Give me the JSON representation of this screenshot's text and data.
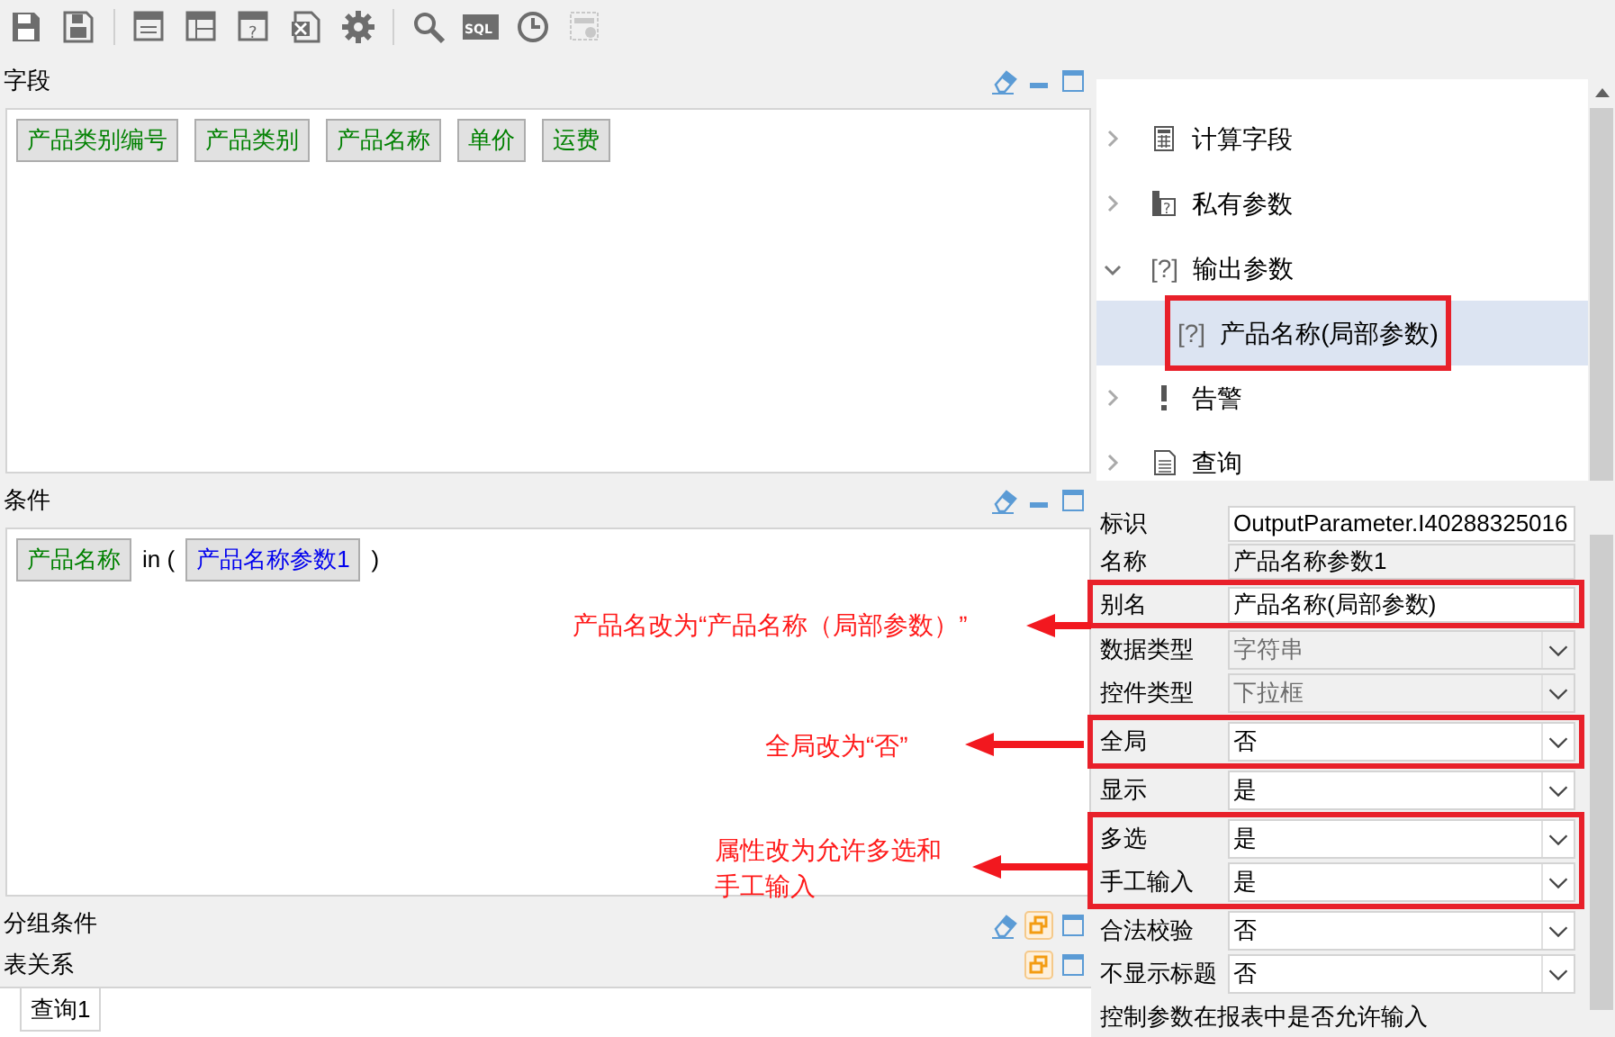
{
  "toolbar": [
    {
      "kind": "save",
      "disabled": false
    },
    {
      "kind": "save-as",
      "disabled": false
    },
    {
      "kind": "layout",
      "disabled": false
    },
    {
      "kind": "table",
      "disabled": false
    },
    {
      "kind": "param",
      "symbol": "?",
      "disabled": false
    },
    {
      "kind": "excel",
      "disabled": false
    },
    {
      "kind": "gear",
      "disabled": false
    },
    {
      "kind": "search",
      "disabled": false
    },
    {
      "kind": "sql",
      "symbol": "SQL",
      "disabled": false
    },
    {
      "kind": "clock",
      "disabled": false
    },
    {
      "kind": "window",
      "disabled": true
    }
  ],
  "fields_panel": {
    "title": "字段",
    "tools": [
      {
        "kind": "eraser"
      },
      {
        "kind": "minimize"
      },
      {
        "kind": "maximize"
      }
    ],
    "chips": [
      "产品类别编号",
      "产品类别",
      "产品名称",
      "单价",
      "运费"
    ]
  },
  "condition_panel": {
    "title": "条件",
    "tools": [
      {
        "kind": "eraser"
      },
      {
        "kind": "minimize"
      },
      {
        "kind": "maximize"
      }
    ],
    "tokens": [
      {
        "kind": "field",
        "text": "产品名称"
      },
      {
        "kind": "text",
        "text": "in ("
      },
      {
        "kind": "param",
        "text": "产品名称参数1"
      },
      {
        "kind": "text",
        "text": ")"
      }
    ]
  },
  "group_panel": {
    "title": "分组条件",
    "tools": [
      {
        "kind": "eraser"
      },
      {
        "kind": "restore"
      },
      {
        "kind": "maximize"
      }
    ]
  },
  "relation_panel": {
    "title": "表关系",
    "tools": [
      {
        "kind": "restore"
      },
      {
        "kind": "maximize"
      }
    ],
    "tabs": [
      {
        "label": "查询1",
        "selected": true
      }
    ]
  },
  "tree": [
    {
      "label": "计算字段",
      "kind": "calculator",
      "expanded": false,
      "selected": false,
      "highlighted": false
    },
    {
      "label": "私有参数",
      "kind": "private-param",
      "symbol": "?",
      "expanded": false,
      "selected": false,
      "highlighted": false
    },
    {
      "label": "输出参数",
      "kind": "param",
      "symbol": "[?]",
      "expanded": true,
      "selected": false,
      "highlighted": false,
      "children": [
        {
          "label": "产品名称(局部参数)",
          "kind": "param",
          "symbol": "[?]",
          "selected": true,
          "highlighted": true
        }
      ]
    },
    {
      "label": "告警",
      "kind": "alert",
      "expanded": false,
      "selected": false,
      "highlighted": false
    },
    {
      "label": "查询",
      "kind": "document",
      "expanded": false,
      "selected": false,
      "highlighted": false
    }
  ],
  "properties": [
    {
      "label": "标识",
      "kind": "text",
      "value": "OutputParameter.I40288325016",
      "disabled": false,
      "highlighted": false
    },
    {
      "label": "名称",
      "kind": "text",
      "value": "产品名称参数1",
      "disabled": true,
      "highlighted": false
    },
    {
      "label": "别名",
      "kind": "text",
      "value": "产品名称(局部参数)",
      "disabled": false,
      "highlighted": true
    },
    {
      "label": "数据类型",
      "kind": "select",
      "value": "字符串",
      "disabled": true,
      "highlighted": false
    },
    {
      "label": "控件类型",
      "kind": "select",
      "value": "下拉框",
      "disabled": true,
      "highlighted": false
    },
    {
      "label": "全局",
      "kind": "select",
      "value": "否",
      "disabled": false,
      "highlighted": true
    },
    {
      "label": "显示",
      "kind": "select",
      "value": "是",
      "disabled": false,
      "highlighted": false
    },
    {
      "label": "多选",
      "kind": "select",
      "value": "是",
      "disabled": false,
      "highlighted": true
    },
    {
      "label": "手工输入",
      "kind": "select",
      "value": "是",
      "disabled": false,
      "highlighted": true
    },
    {
      "label": "合法校验",
      "kind": "select",
      "value": "否",
      "disabled": false,
      "highlighted": false
    },
    {
      "label": "不显示标题",
      "kind": "select",
      "value": "否",
      "disabled": false,
      "highlighted": false
    }
  ],
  "property_description": "控制参数在报表中是否允许输入",
  "annotations": [
    {
      "lines": [
        "产品名改为“产品名称（局部参数）”"
      ]
    },
    {
      "lines": [
        "全局改为“否”"
      ]
    },
    {
      "lines": [
        "属性改为允许多选和",
        "手工输入"
      ]
    }
  ]
}
